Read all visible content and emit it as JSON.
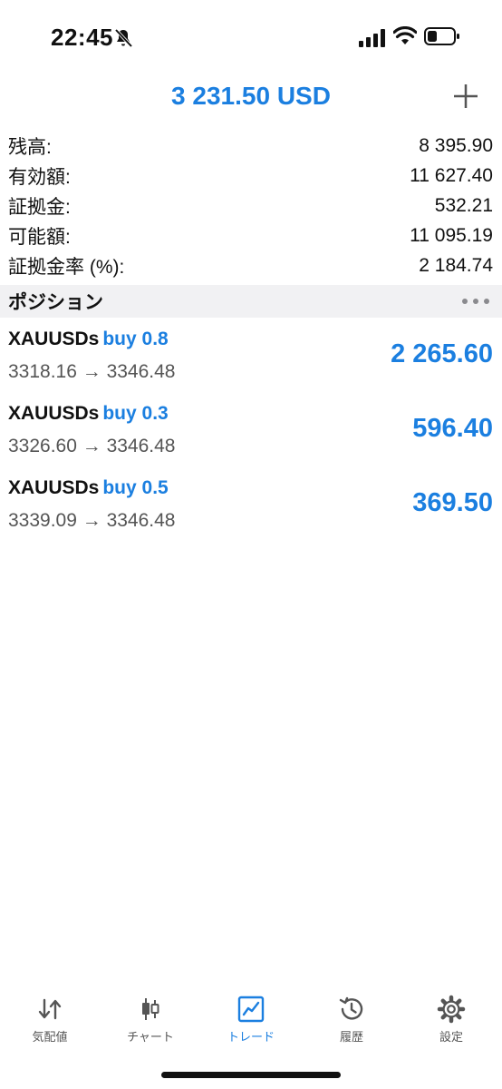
{
  "status_bar": {
    "time": "22:45"
  },
  "header": {
    "title": "3 231.50 USD"
  },
  "summary": [
    {
      "label": "残高:",
      "value": "8 395.90"
    },
    {
      "label": "有効額:",
      "value": "11 627.40"
    },
    {
      "label": "証拠金:",
      "value": "532.21"
    },
    {
      "label": "可能額:",
      "value": "11 095.19"
    },
    {
      "label": "証拠金率 (%):",
      "value": "2 184.74"
    }
  ],
  "positions_section": {
    "title": "ポジション"
  },
  "positions": [
    {
      "symbol": "XAUUSDs",
      "side": "buy 0.8",
      "prices": "3318.16 → 3346.48",
      "profit": "2 265.60"
    },
    {
      "symbol": "XAUUSDs",
      "side": "buy 0.3",
      "prices": "3326.60 → 3346.48",
      "profit": "596.40"
    },
    {
      "symbol": "XAUUSDs",
      "side": "buy 0.5",
      "prices": "3339.09 → 3346.48",
      "profit": "369.50"
    }
  ],
  "tabs": [
    {
      "label": "気配値",
      "icon": "quotes-arrows-icon"
    },
    {
      "label": "チャート",
      "icon": "candlestick-icon"
    },
    {
      "label": "トレード",
      "icon": "trade-chart-icon",
      "active": true
    },
    {
      "label": "履歴",
      "icon": "history-icon"
    },
    {
      "label": "設定",
      "icon": "settings-gear-icon"
    }
  ],
  "colors": {
    "accent": "#1b7fe0",
    "section_bg": "#f1f1f3",
    "text": "#111111",
    "muted": "#555555"
  }
}
